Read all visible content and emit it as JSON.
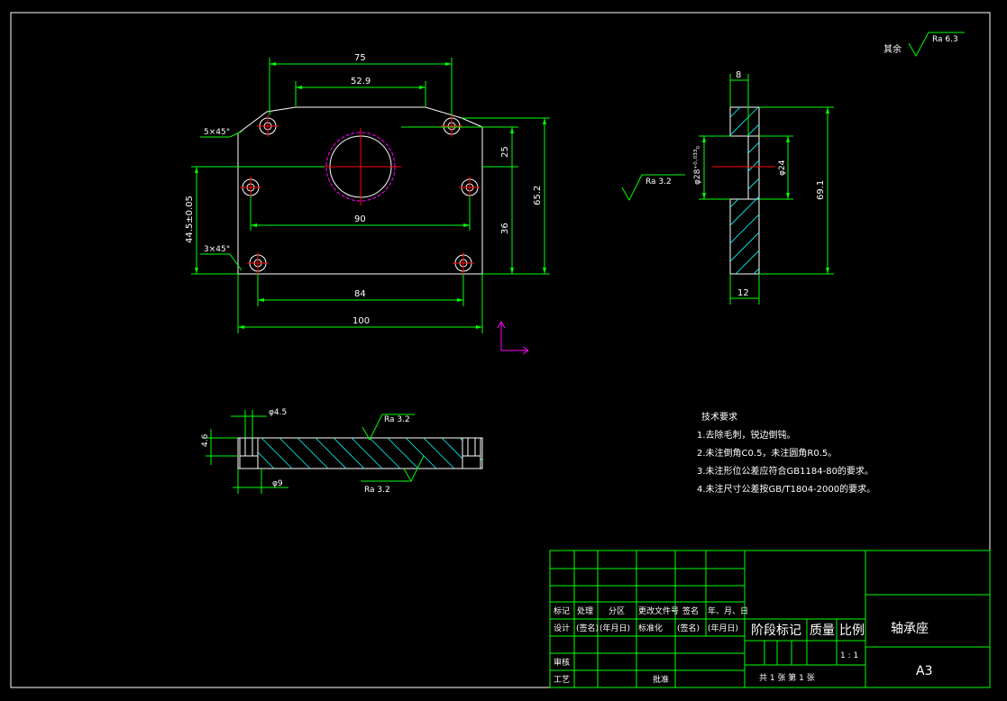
{
  "colors": {
    "background": "#000000",
    "outline": "#ffffff",
    "dimension": "#00ff00",
    "center": "#ff0000",
    "hidden": "#ff00ff",
    "hatch": "#00ffff",
    "text": "#ffffff",
    "frame": "#00ff00"
  },
  "roughness_note": {
    "label": "其余",
    "value": "Ra 6.3"
  },
  "front_view": {
    "dims": {
      "overall_top": "75",
      "top_inner": "52.9",
      "chamfer_top": "5×45°",
      "chamfer_bottom": "3×45°",
      "hole_spacing_mid": "90",
      "hole_spacing_bottom": "84",
      "overall_width": "100",
      "right_upper": "25",
      "right_lower": "36",
      "overall_height": "65.2",
      "left_height": "44.5±0.05"
    }
  },
  "side_view": {
    "dims": {
      "top": "8",
      "bottom": "12",
      "bore": "φ28⁺⁰·⁰³³₀",
      "inner": "φ24",
      "height": "69.1",
      "roughness": "Ra 3.2"
    }
  },
  "section_view": {
    "dims": {
      "hole_small": "φ4.5",
      "hole_large": "φ9",
      "thickness": "4.6",
      "roughness_top": "Ra 3.2",
      "roughness_bottom": "Ra 3.2"
    }
  },
  "technical_requirements": {
    "title": "技术要求",
    "items": [
      "1.去除毛刺，锐边倒钝。",
      "2.未注倒角C0.5，未注圆角R0.5。",
      "3.未注形位公差应符合GB1184-80的要求。",
      "4.未注尺寸公差按GB/T1804-2000的要求。"
    ]
  },
  "title_block": {
    "header": [
      "标记",
      "处理",
      "分区",
      "更改文件号",
      "签名",
      "年、月、日"
    ],
    "design_row": [
      "设计",
      "(签名)",
      "(年月日)",
      "标准化",
      "(签名)",
      "(年月日)"
    ],
    "audit": "审核",
    "process": "工艺",
    "approve": "批准",
    "stage_mark": "阶段标记",
    "weight": "质量",
    "scale": "比例",
    "scale_value": "1 : 1",
    "sheet_info": "共 1 张 第 1 张",
    "part_name": "轴承座",
    "paper_size": "A3"
  }
}
